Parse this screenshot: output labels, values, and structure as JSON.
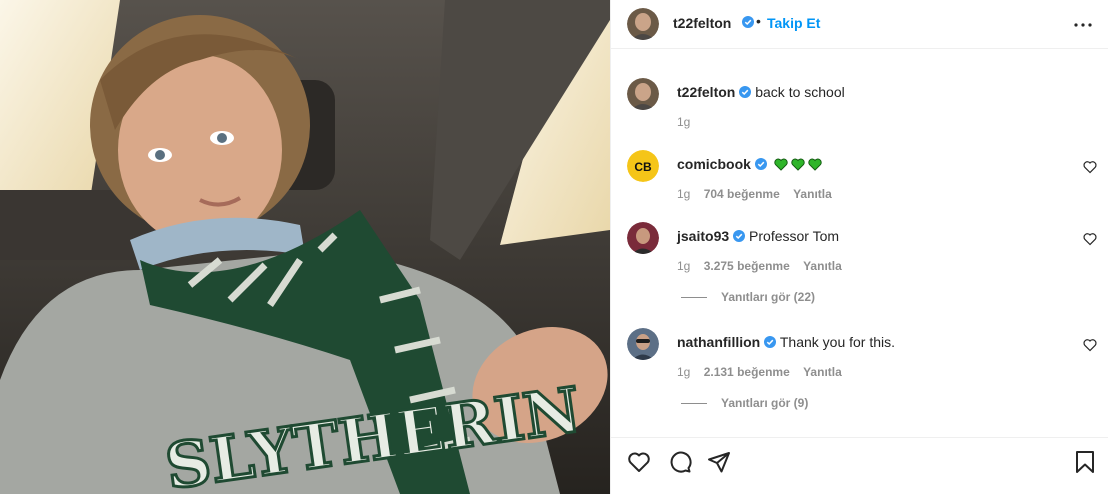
{
  "post": {
    "image_alt": "Selfie in a car wearing a Slytherin sweater and green-white scarf",
    "image_text": "SLYTHERIN"
  },
  "header": {
    "username": "t22felton",
    "dot": "•",
    "follow_label": "Takip Et",
    "icons": {
      "verified": "verified-badge-icon",
      "more": "more-options-icon"
    }
  },
  "caption": {
    "username": "t22felton",
    "text": "back to school",
    "time": "1g"
  },
  "comments": [
    {
      "username": "comicbook",
      "avatar_text": "CB",
      "text": "",
      "emoji": [
        "green-heart",
        "green-heart",
        "green-heart"
      ],
      "time": "1g",
      "likes": "704 beğenme",
      "reply_label": "Yanıtla"
    },
    {
      "username": "jsaito93",
      "text": "Professor Tom",
      "time": "1g",
      "likes": "3.275 beğenme",
      "reply_label": "Yanıtla",
      "view_replies": "Yanıtları gör (22)"
    },
    {
      "username": "nathanfillion",
      "text": "Thank you for this.",
      "time": "1g",
      "likes": "2.131 beğenme",
      "reply_label": "Yanıtla",
      "view_replies": "Yanıtları gör (9)"
    }
  ],
  "actions": {
    "icons": [
      "heart-icon",
      "comment-icon",
      "share-icon",
      "bookmark-icon"
    ]
  },
  "colors": {
    "link": "#0095f6",
    "verified": "#3897f0",
    "muted": "#8e8e8e",
    "green_heart": "#2fb52a"
  }
}
